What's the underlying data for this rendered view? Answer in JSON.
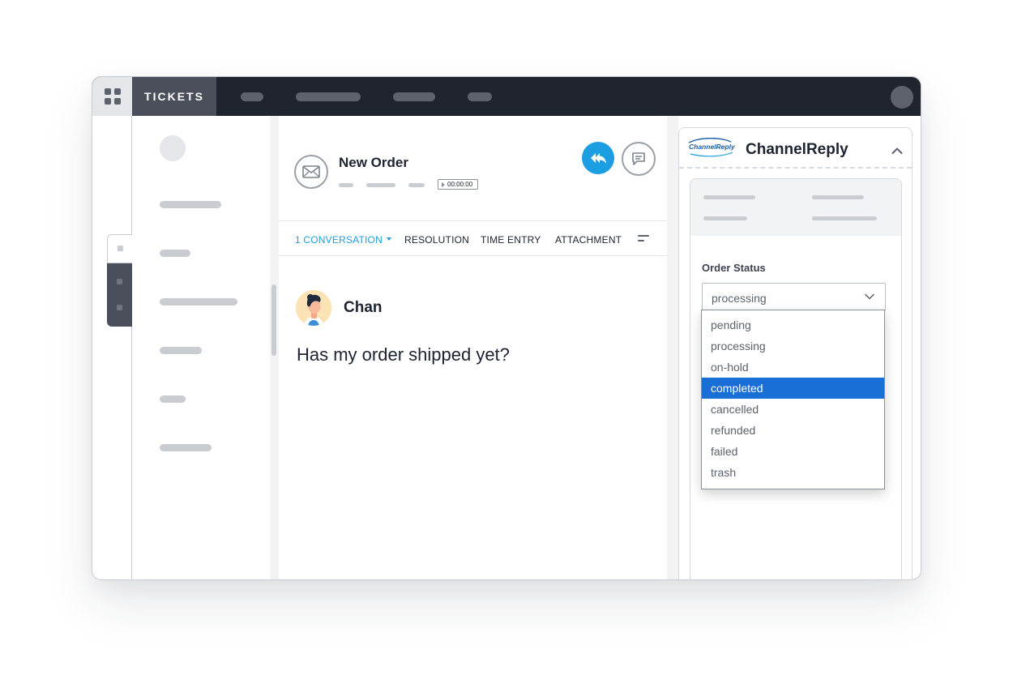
{
  "topbar": {
    "tickets_tab": "TICKETS"
  },
  "ticket": {
    "title": "New Order",
    "timer": "00:00:00"
  },
  "tabs": [
    {
      "label": "1 CONVERSATION"
    },
    {
      "label": "RESOLUTION"
    },
    {
      "label": "TIME ENTRY"
    },
    {
      "label": "ATTACHMENT"
    }
  ],
  "message": {
    "author": "Chan",
    "body": "Has my order shipped yet?"
  },
  "panel": {
    "logo_text": "ChannelReply",
    "title": "ChannelReply",
    "order_status_label": "Order Status",
    "order_status_value": "processing",
    "options": [
      "pending",
      "processing",
      "on-hold",
      "completed",
      "cancelled",
      "refunded",
      "failed",
      "trash"
    ],
    "highlighted_option": "completed"
  },
  "colors": {
    "accent": "#1b9fe2",
    "topbar": "#20242f",
    "highlight": "#1a6fd6"
  }
}
